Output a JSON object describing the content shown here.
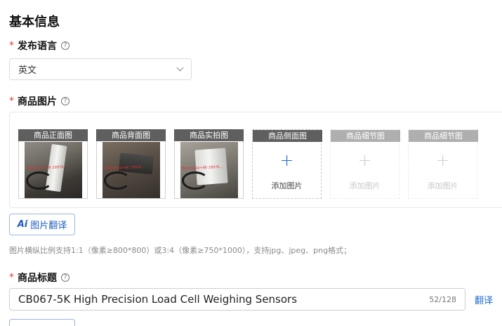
{
  "section": {
    "title": "基本信息"
  },
  "language": {
    "required_mark": "*",
    "label": "发布语言",
    "help": "?",
    "selected": "英文"
  },
  "images": {
    "required_mark": "*",
    "label": "商品图片",
    "help": "?",
    "watermark": "WhatsApp+86 18976...",
    "slots": [
      {
        "caption": "商品正面图",
        "state": "filled"
      },
      {
        "caption": "商品背面图",
        "state": "filled"
      },
      {
        "caption": "商品实拍图",
        "state": "filled"
      },
      {
        "caption": "商品侧面图",
        "state": "empty",
        "plus": "+",
        "add_label": "添加图片"
      },
      {
        "caption": "商品细节图",
        "state": "disabled",
        "plus": "+",
        "add_label": "添加图片"
      },
      {
        "caption": "商品细节图",
        "state": "disabled",
        "plus": "+",
        "add_label": "添加图片"
      }
    ],
    "ai_button": {
      "icon": "Ai",
      "label": "图片翻译"
    },
    "hint": "图片横纵比例支持1:1（像素≥800*800）或3:4（像素≥750*1000），支持jpg、jpeg、png格式；"
  },
  "product_title": {
    "required_mark": "*",
    "label": "商品标题",
    "help": "?",
    "value": "CB067-5K  High Precision  Load Cell Weighing Sensors",
    "count": "52/128",
    "translate_link": "翻译"
  },
  "colors": {
    "accent": "#1f6fd1",
    "required": "#e23b2e"
  }
}
